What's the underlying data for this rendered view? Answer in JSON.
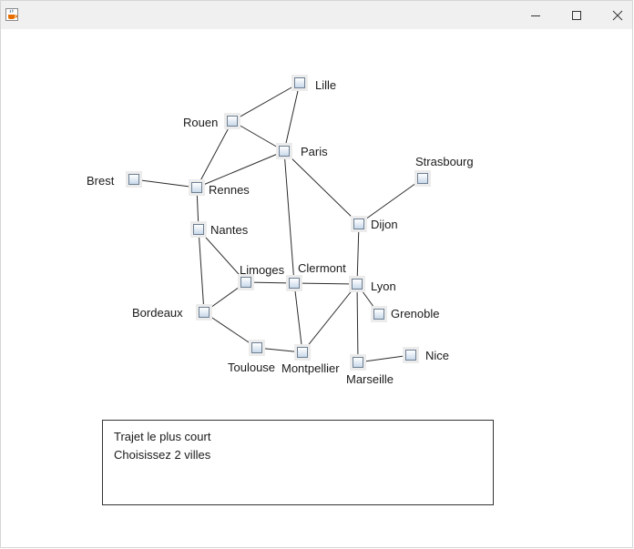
{
  "window": {
    "app_icon": "java-cup-icon",
    "controls": [
      "minimize-icon",
      "maximize-icon",
      "close-icon"
    ]
  },
  "cities": {
    "lille": "Lille",
    "rouen": "Rouen",
    "paris": "Paris",
    "brest": "Brest",
    "rennes": "Rennes",
    "strasbourg": "Strasbourg",
    "nantes": "Nantes",
    "dijon": "Dijon",
    "limoges": "Limoges",
    "clermont": "Clermont",
    "lyon": "Lyon",
    "bordeaux": "Bordeaux",
    "grenoble": "Grenoble",
    "toulouse": "Toulouse",
    "montpellier": "Montpellier",
    "marseille": "Marseille",
    "nice": "Nice"
  },
  "connections": [
    [
      "lille",
      "rouen"
    ],
    [
      "lille",
      "paris"
    ],
    [
      "rouen",
      "paris"
    ],
    [
      "rouen",
      "rennes"
    ],
    [
      "paris",
      "rennes"
    ],
    [
      "paris",
      "dijon"
    ],
    [
      "paris",
      "clermont"
    ],
    [
      "brest",
      "rennes"
    ],
    [
      "rennes",
      "nantes"
    ],
    [
      "strasbourg",
      "dijon"
    ],
    [
      "dijon",
      "lyon"
    ],
    [
      "nantes",
      "limoges"
    ],
    [
      "nantes",
      "bordeaux"
    ],
    [
      "limoges",
      "bordeaux"
    ],
    [
      "limoges",
      "clermont"
    ],
    [
      "clermont",
      "lyon"
    ],
    [
      "clermont",
      "montpellier"
    ],
    [
      "lyon",
      "grenoble"
    ],
    [
      "lyon",
      "montpellier"
    ],
    [
      "lyon",
      "marseille"
    ],
    [
      "bordeaux",
      "toulouse"
    ],
    [
      "toulouse",
      "montpellier"
    ],
    [
      "marseille",
      "nice"
    ]
  ],
  "info": {
    "title": "Trajet le plus court",
    "instruction": "Choisissez 2 villes"
  }
}
